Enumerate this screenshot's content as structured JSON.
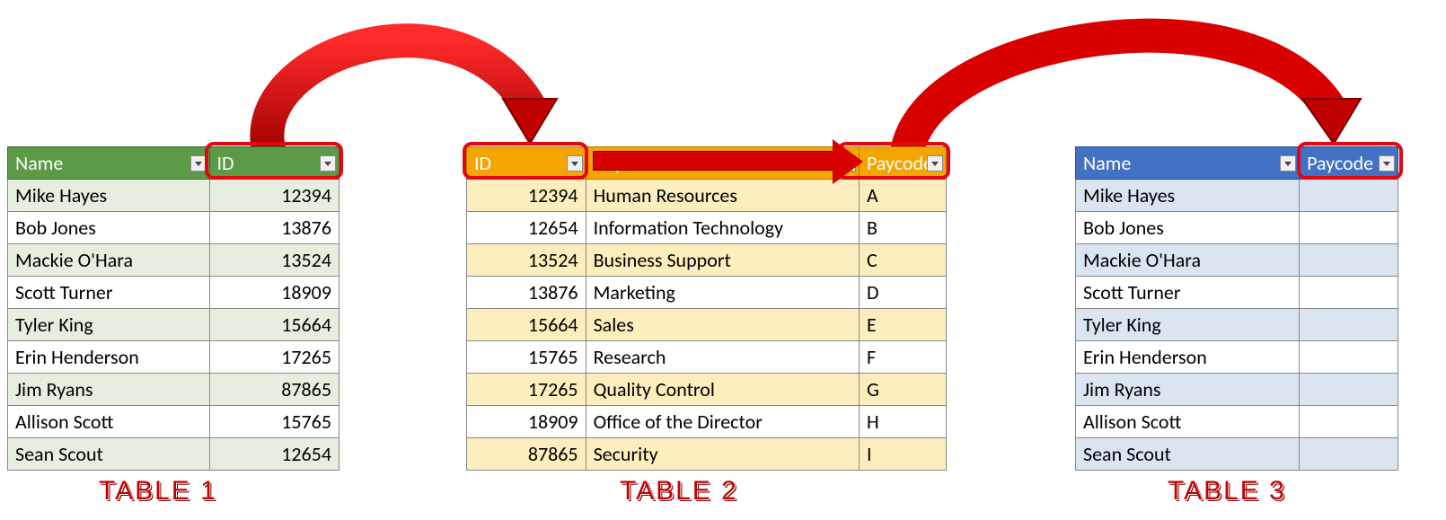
{
  "captions": {
    "t1": "TABLE 1",
    "t2": "TABLE 2",
    "t3": "TABLE 3"
  },
  "table1": {
    "headers": {
      "name": "Name",
      "id": "ID"
    },
    "rows": [
      {
        "name": "Mike Hayes",
        "id": "12394"
      },
      {
        "name": "Bob Jones",
        "id": "13876"
      },
      {
        "name": "Mackie O'Hara",
        "id": "13524"
      },
      {
        "name": "Scott Turner",
        "id": "18909"
      },
      {
        "name": "Tyler King",
        "id": "15664"
      },
      {
        "name": "Erin Henderson",
        "id": "17265"
      },
      {
        "name": "Jim Ryans",
        "id": "87865"
      },
      {
        "name": "Allison Scott",
        "id": "15765"
      },
      {
        "name": "Sean Scout",
        "id": "12654"
      }
    ]
  },
  "table2": {
    "headers": {
      "id": "ID",
      "dept": "Department",
      "paycode": "Paycode"
    },
    "rows": [
      {
        "id": "12394",
        "dept": "Human Resources",
        "paycode": "A"
      },
      {
        "id": "12654",
        "dept": "Information Technology",
        "paycode": "B"
      },
      {
        "id": "13524",
        "dept": "Business Support",
        "paycode": "C"
      },
      {
        "id": "13876",
        "dept": "Marketing",
        "paycode": "D"
      },
      {
        "id": "15664",
        "dept": "Sales",
        "paycode": "E"
      },
      {
        "id": "15765",
        "dept": "Research",
        "paycode": "F"
      },
      {
        "id": "17265",
        "dept": "Quality Control",
        "paycode": "G"
      },
      {
        "id": "18909",
        "dept": "Office of the Director",
        "paycode": "H"
      },
      {
        "id": "87865",
        "dept": "Security",
        "paycode": "I"
      }
    ]
  },
  "table3": {
    "headers": {
      "name": "Name",
      "paycode": "Paycode"
    },
    "rows": [
      {
        "name": "Mike Hayes",
        "paycode": ""
      },
      {
        "name": "Bob Jones",
        "paycode": ""
      },
      {
        "name": "Mackie O'Hara",
        "paycode": ""
      },
      {
        "name": "Scott Turner",
        "paycode": ""
      },
      {
        "name": "Tyler King",
        "paycode": ""
      },
      {
        "name": "Erin Henderson",
        "paycode": ""
      },
      {
        "name": "Jim Ryans",
        "paycode": ""
      },
      {
        "name": "Allison Scott",
        "paycode": ""
      },
      {
        "name": "Sean Scout",
        "paycode": ""
      }
    ]
  }
}
